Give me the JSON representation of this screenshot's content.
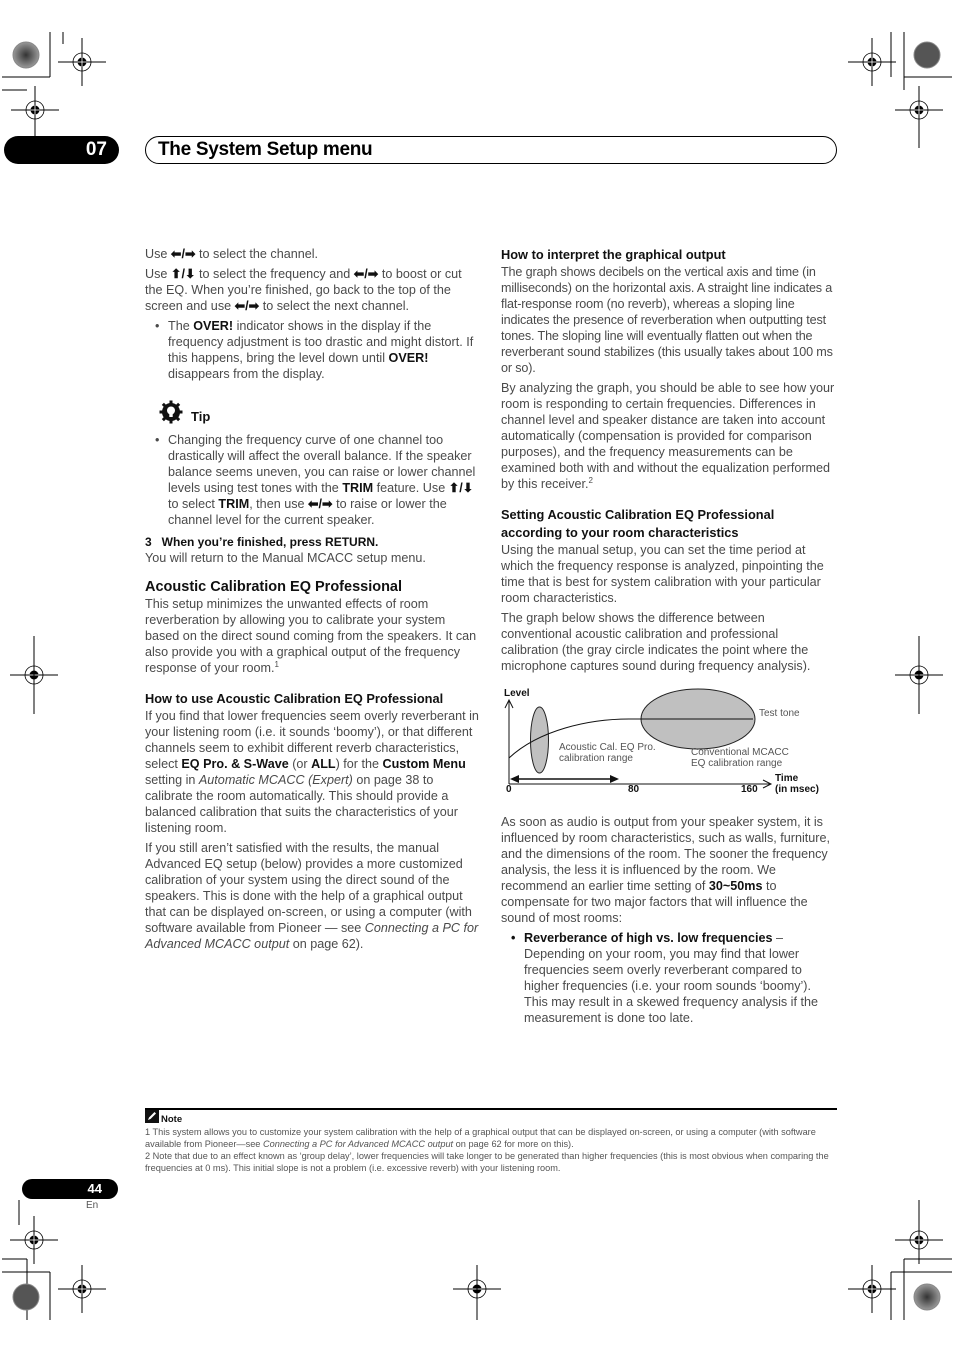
{
  "header": {
    "chapter_number": "07",
    "chapter_title": "The System Setup menu"
  },
  "left_column": {
    "p1": {
      "pre": "Use ",
      "icon": "⬅/➡",
      "post": " to select the channel."
    },
    "p2": {
      "pre": "Use ",
      "icon1": "⬆/⬇",
      "mid": " to select the frequency and ",
      "icon2": "⬅/➡",
      "post": " to boost or cut the EQ. When you’re finished, go back to the top of the screen and use ",
      "icon3": "⬅/➡",
      "end": " to select the next channel."
    },
    "bullet1": {
      "pre": "The ",
      "bold1": "OVER!",
      "mid": " indicator shows in the display if the frequency adjustment is too drastic and might distort. If this happens, bring the level down until ",
      "bold2": "OVER!",
      "post": " disappears from the display."
    },
    "tip": {
      "label": "Tip",
      "icon": "lightbulb-gear-icon",
      "bullet": {
        "pre": "Changing the frequency curve of one channel too drastically will affect the overall balance. If the speaker balance seems uneven, you can raise or lower channel levels using test tones with the ",
        "bold1": "TRIM",
        "mid1": " feature. Use ",
        "icon1": "⬆/⬇",
        "mid2": " to select ",
        "bold2": "TRIM",
        "mid3": ", then use ",
        "icon2": "⬅/➡",
        "post": " to raise or lower the channel level for the current speaker."
      }
    },
    "step3": {
      "label": "3   When you’re finished, press RETURN.",
      "text": "You will return to the Manual MCACC setup menu."
    },
    "section_title": "Acoustic Calibration EQ Professional",
    "section_text": "This setup minimizes the unwanted effects of room reverberation by allowing you to calibrate your system based on the direct sound coming from the speakers. It can also provide you with a graphical output of the frequency response of your room.",
    "section_footnote_ref": "1",
    "howto_title": "How to use Acoustic Calibration EQ Professional",
    "howto_p1": {
      "pre": "If you find that lower frequencies seem overly reverberant in your listening room (i.e. it sounds ‘boomy’), or that different channels seem to exhibit different reverb characteristics, select ",
      "bold1": "EQ Pro. & S-Wave",
      "mid1": " (or ",
      "bold2": "ALL",
      "mid2": ") for the ",
      "bold3": "Custom Menu",
      "mid3": " setting in ",
      "ital": "Automatic MCACC (Expert)",
      "post": " on page 38 to calibrate the room automatically. This should provide a balanced calibration that suits the characteristics of your listening room."
    },
    "howto_p2": {
      "pre": "If you still aren’t satisfied with the results, the manual Advanced EQ setup (below) provides a more customized calibration of your system using the direct sound of the speakers. This is done with the help of a graphical output that can be displayed on-screen, or using a computer (with software available from Pioneer — see ",
      "ital": "Connecting a PC for Advanced MCACC output",
      "post": " on page 62)."
    }
  },
  "right_column": {
    "interpret_title": "How to interpret the graphical output",
    "interpret_p1": "The graph shows decibels on the vertical axis and time (in milliseconds) on the horizontal axis. A straight line indicates a flat-response room (no reverb), whereas a sloping line indicates the presence of reverberation when outputting test tones. The sloping line will eventually flatten out when the reverberant sound stabilizes (this usually takes about 100 ms or so).",
    "interpret_p2": "By analyzing the graph, you should be able to see how your room is responding to certain frequencies. Differences in channel level and speaker distance are taken into account automatically (compensation is provided for comparison purposes), and the frequency measurements can be examined both with and without the equalization performed by this receiver.",
    "interpret_footnote_ref": "2",
    "setting_title": "Setting Acoustic Calibration EQ Professional according to your room characteristics",
    "setting_p1": "Using the manual setup, you can set the time period at which the frequency response is analyzed, pinpointing the time that is best for system calibration with your particular room characteristics.",
    "setting_p2": "The graph below shows the difference between conventional acoustic calibration and professional calibration (the gray circle indicates the point where the microphone captures sound during frequency analysis).",
    "audio_p": {
      "pre": "As soon as audio is output from your speaker system, it is influenced by room characteristics, such as walls, furniture, and the dimensions of the room. The sooner the frequency analysis, the less it is influenced by the room. We recommend an earlier time setting of ",
      "bold": "30~50ms",
      "post": " to compensate for two major factors that will influence the sound of most rooms:"
    },
    "bullet": {
      "bold": "Reverberance of high vs. low frequencies",
      "dash": " – ",
      "text": "Depending on your room, you may find that lower frequencies seem overly reverberant compared to higher frequencies (i.e. your room sounds ‘boomy’). This may result in a skewed frequency analysis if the measurement is done too late."
    }
  },
  "diagram": {
    "y_label": "Level",
    "x_label_line1": "Time",
    "x_label_line2": "(in msec)",
    "x_ticks": [
      "0",
      "80",
      "160"
    ],
    "x_range": [
      0,
      160
    ],
    "curve_label": "Test tone",
    "pro_range_label_line1": "Acoustic Cal. EQ Pro.",
    "pro_range_label_line2": "calibration range",
    "conv_range_label_line1": "Conventional MCACC",
    "conv_range_label_line2": "EQ calibration range",
    "pro_range_center_ms": 25,
    "conv_range_center_ms": 126,
    "arrow_span_ms": [
      0,
      80
    ],
    "ellipse_color": "#c0c0c0"
  },
  "notes": {
    "label": "Note",
    "n1": {
      "pre": "1 This system allows you to customize your system calibration with the help of a graphical output that can be displayed on-screen, or using a computer (with software available from Pioneer—see ",
      "ital": "Connecting a PC for Advanced MCACC output",
      "post": " on page 62 for more on this)."
    },
    "n2": "2 Note that due to an effect known as ‘group delay’, lower frequencies will take longer to be generated than higher frequencies (this is most obvious when comparing the frequencies at 0 ms). This initial slope is not a problem (i.e. excessive reverb) with your listening room."
  },
  "footer": {
    "page_number": "44",
    "language": "En"
  }
}
